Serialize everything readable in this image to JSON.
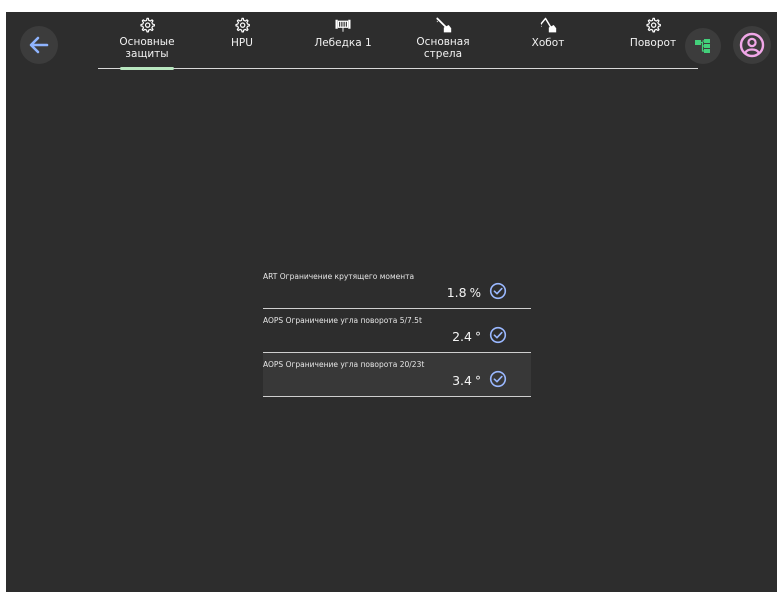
{
  "colors": {
    "screen_bg": "#2d2d2d",
    "accent_blue": "#8fb4ff",
    "tab_underline": "#b8e6bf",
    "check_blue": "#9ab8ff",
    "tree_green": "#43d07a",
    "user_pink": "#f1a7e8"
  },
  "nav": {
    "back_icon": "arrow-left-icon",
    "tree_icon": "tree-structure-icon",
    "user_icon": "user-circle-icon"
  },
  "tabs": [
    {
      "label": "Основные\nзащиты",
      "icon": "gear-icon",
      "active": true
    },
    {
      "label": "HPU",
      "icon": "gear-icon",
      "active": false
    },
    {
      "label": "Лебедка 1",
      "icon": "winch-icon",
      "active": false
    },
    {
      "label": "Основная\nстрела",
      "icon": "crane-boom-icon",
      "active": false
    },
    {
      "label": "Хобот",
      "icon": "jib-icon",
      "active": false
    },
    {
      "label": "Поворот",
      "icon": "gear-icon",
      "active": false
    }
  ],
  "protections": [
    {
      "label": "ART Ограничение крутящего момента",
      "value": "1.8",
      "unit": "%",
      "status": "ok"
    },
    {
      "label": "AOPS Ограничение угла поворота 5/7.5t",
      "value": "2.4",
      "unit": "°",
      "status": "ok"
    },
    {
      "label": "AOPS Ограничение угла поворота 20/23t",
      "value": "3.4",
      "unit": "°",
      "status": "ok"
    }
  ]
}
